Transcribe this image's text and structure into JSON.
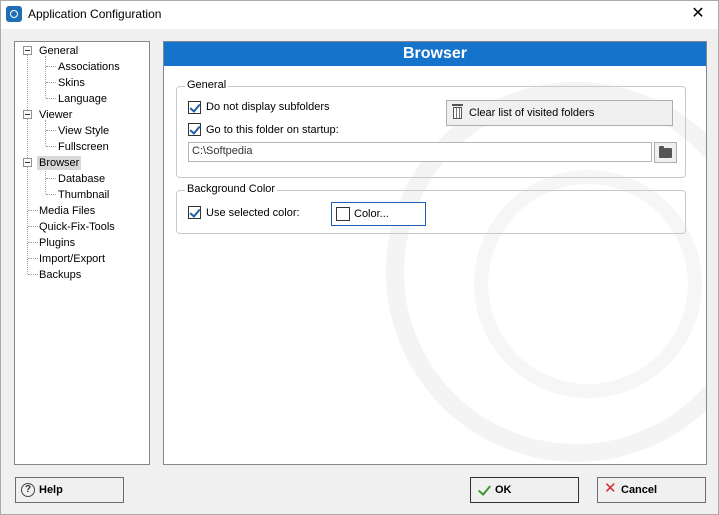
{
  "window": {
    "title": "Application Configuration",
    "close_glyph": "✕"
  },
  "tree": {
    "items": [
      {
        "label": "General",
        "level": 0,
        "expanded": true
      },
      {
        "label": "Associations",
        "level": 1
      },
      {
        "label": "Skins",
        "level": 1
      },
      {
        "label": "Language",
        "level": 1
      },
      {
        "label": "Viewer",
        "level": 0,
        "expanded": true
      },
      {
        "label": "View Style",
        "level": 1
      },
      {
        "label": "Fullscreen",
        "level": 1
      },
      {
        "label": "Browser",
        "level": 0,
        "expanded": true,
        "selected": true
      },
      {
        "label": "Database",
        "level": 1
      },
      {
        "label": "Thumbnail",
        "level": 1
      },
      {
        "label": "Media Files",
        "level": 0
      },
      {
        "label": "Quick-Fix-Tools",
        "level": 0
      },
      {
        "label": "Plugins",
        "level": 0
      },
      {
        "label": "Import/Export",
        "level": 0
      },
      {
        "label": "Backups",
        "level": 0
      }
    ]
  },
  "panel": {
    "header": "Browser",
    "general": {
      "legend": "General",
      "no_subfolders_label": "Do not display subfolders",
      "no_subfolders_checked": true,
      "goto_folder_label": "Go to this folder on startup:",
      "goto_folder_checked": true,
      "clear_button_label": "Clear list of visited folders",
      "folder_path": "C:\\Softpedia"
    },
    "background": {
      "legend": "Background Color",
      "use_color_label": "Use selected color:",
      "use_color_checked": true,
      "color_button_label": "Color..."
    }
  },
  "buttons": {
    "help": "Help",
    "ok": "OK",
    "cancel": "Cancel"
  },
  "colors": {
    "accent": "#1673cc",
    "check": "#1e5fa8",
    "ok_icon": "#3c9b2d",
    "cancel_icon": "#d12b2b"
  }
}
